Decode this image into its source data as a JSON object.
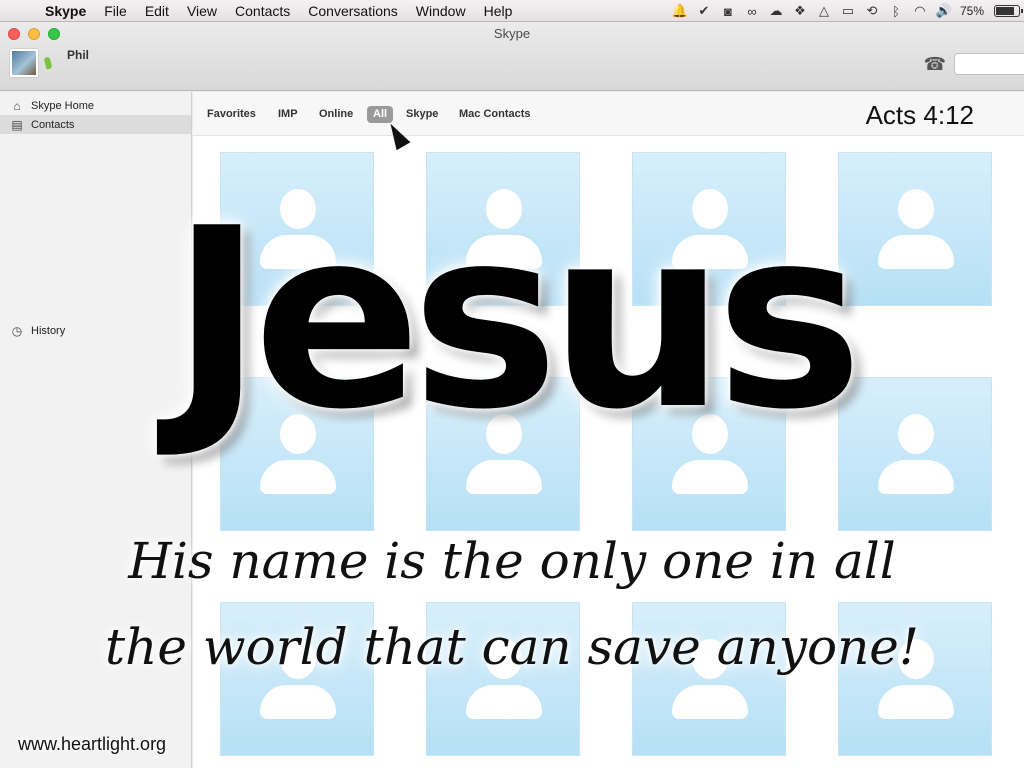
{
  "menubar": {
    "app": "Skype",
    "items": [
      "File",
      "Edit",
      "View",
      "Contacts",
      "Conversations",
      "Window",
      "Help"
    ],
    "battery": "75%"
  },
  "window": {
    "title": "Skype"
  },
  "profile": {
    "name": "Phil"
  },
  "sidebar": {
    "items": [
      {
        "label": "Skype Home",
        "icon": "home-icon"
      },
      {
        "label": "Contacts",
        "icon": "contacts-book-icon"
      },
      {
        "label": "History",
        "icon": "clock-icon"
      }
    ]
  },
  "filters": [
    "Favorites",
    "IMP",
    "Online",
    "All",
    "Skype",
    "Mac Contacts"
  ],
  "active_filter": "All",
  "overlay": {
    "verse": "Acts 4:12",
    "title": "Jesus",
    "line1": "His name is the only one in all",
    "line2": "the world that can save anyone!",
    "credit": "www.heartlight.org"
  }
}
